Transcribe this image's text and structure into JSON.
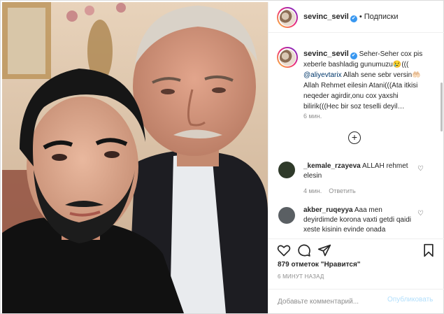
{
  "post": {
    "username": "sevinc_sevil",
    "verified_mark": "✔",
    "header_separator": "•",
    "follow_label": "Подписки",
    "photo_alt": "selfie photo"
  },
  "caption": {
    "username": "sevinc_sevil",
    "text_part1": "Seher-Seher cox pis xeberle bashladig gunumuzu😢(((",
    "mention": "@aliyevtarix",
    "text_part2": "Allah sene sebr versin🤲🏻 Allah Rehmet eilesin Atani(((Ata itkisi neqeder agirdir,onu cox yaxshi bilirik(((Hec bir soz teselli deyil…",
    "time": "6 мин."
  },
  "load_more_icon": "plus-circle-icon",
  "comments": [
    {
      "username": "_kemale_rzayeva",
      "text": "ALLAH rehmet elesin",
      "time": "4 мин.",
      "reply_label": "Ответить",
      "avatar_color": "#2f3a2a"
    },
    {
      "username": "akber_ruqeyya",
      "text": "Aaa men deyirdimde korona vaxti getdi qaidi xeste kisinin evinde onada",
      "time": "",
      "reply_label": "",
      "avatar_color": "#5a5f63"
    }
  ],
  "actions": {
    "icons": [
      "heart-icon",
      "comment-icon",
      "share-icon",
      "bookmark-icon"
    ]
  },
  "likes": {
    "count": "879",
    "label": "отметок \"Нравится\""
  },
  "post_time": "6 МИНУТ НАЗАД",
  "add_comment": {
    "placeholder": "Добавьте комментарий...",
    "publish_label": "Опубликовать"
  },
  "colors": {
    "link": "#00376b",
    "verified": "#3897f0",
    "muted": "#8e8e8e",
    "publish_disabled": "#b2dffc"
  }
}
